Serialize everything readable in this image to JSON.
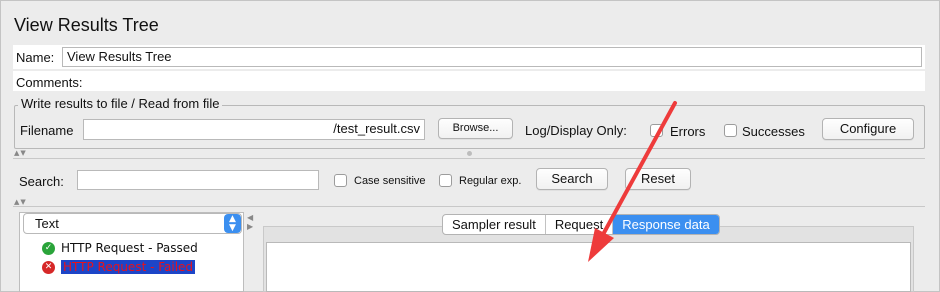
{
  "window": {
    "title": "View Results Tree"
  },
  "name_row": {
    "label": "Name:",
    "value": "View Results Tree"
  },
  "comments_row": {
    "label": "Comments:"
  },
  "file_group": {
    "legend": "Write results to file / Read from file",
    "filename_label": "Filename",
    "filename_value": "/test_result.csv",
    "browse_label": "Browse...",
    "log_display_label": "Log/Display Only:",
    "errors_label": "Errors",
    "successes_label": "Successes",
    "configure_label": "Configure"
  },
  "search": {
    "label": "Search:",
    "case_sensitive_label": "Case sensitive",
    "regular_exp_label": "Regular exp.",
    "search_button": "Search",
    "reset_button": "Reset"
  },
  "renderer": {
    "selected": "Text"
  },
  "tree": {
    "items": [
      {
        "label": "HTTP Request - Passed",
        "status": "passed",
        "icon": "check-shield-icon"
      },
      {
        "label": "HTTP Request - Failed",
        "status": "failed",
        "icon": "x-shield-icon"
      }
    ]
  },
  "tabs": [
    {
      "label": "Sampler result",
      "active": false
    },
    {
      "label": "Request",
      "active": false
    },
    {
      "label": "Response data",
      "active": true
    }
  ],
  "colors": {
    "accent": "#3b8ff0",
    "arrow": "#ee3b3b",
    "selection": "#1d45c7",
    "failed_text": "#e8121b",
    "passed_icon": "#2aa43a",
    "failed_icon": "#d62828"
  }
}
